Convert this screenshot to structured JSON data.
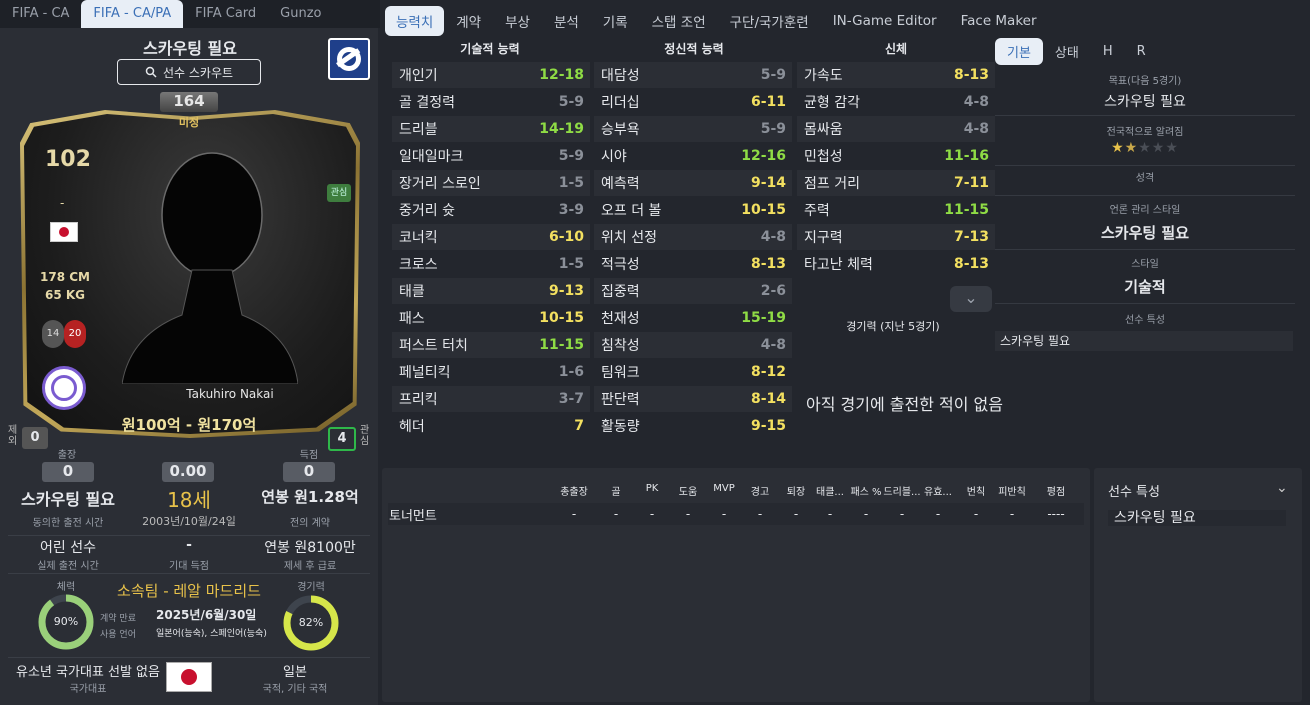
{
  "left_tabs": [
    "FIFA - CA",
    "FIFA - CA/PA",
    "FIFA Card",
    "Gunzo"
  ],
  "player": {
    "title": "스카우팅 필요",
    "scout_button": "선수 스카우트",
    "ca": "164",
    "ca_label": "미정",
    "rating": "102",
    "position": "-",
    "height": "178 CM",
    "weight": "65 KG",
    "num1": "14",
    "num2": "20",
    "interest_tag": "관심",
    "name": "Takuhiro Nakai",
    "value": "원100억 - 원170억",
    "left_box_label": "제외",
    "left_box_val": "0",
    "right_box_val": "4",
    "right_box_label": "관심"
  },
  "stats": {
    "apps_label": "출장",
    "apps": "0",
    "rating": "0.00",
    "goals_label": "득점",
    "goals": "0",
    "playtime": "스카우팅 필요",
    "playtime_label": "동의한 출전 시간",
    "age": "18세",
    "dob": "2003년/10월/24일",
    "wage": "연봉 원1.28억",
    "wage_label": "전의 계약",
    "real_time": "어린 선수",
    "real_time_label": "실제 출전 시간",
    "exp_goals": "-",
    "exp_goals_label": "기대 득점",
    "wage2": "연봉 원8100만",
    "wage2_label": "제세 후 급료",
    "fitness_label": "체력",
    "fitness": "90%",
    "club": "소속팀 - 레알 마드리드",
    "contract_label": "계약 만료",
    "contract": "2025년/6월/30일",
    "lang_label": "사용 언어",
    "langs": "일본어(능숙), 스페인어(능숙)",
    "match_label": "경기력",
    "match": "82%",
    "youth": "유소년 국가대표 선발 없음",
    "youth_label": "국가대표",
    "nation": "일본",
    "nation_label": "국적, 기타 국적"
  },
  "nav": [
    "능력치",
    "계약",
    "부상",
    "분석",
    "기록",
    "스탭 조언",
    "구단/국가훈련",
    "IN-Game Editor",
    "Face Maker"
  ],
  "attr_heads": [
    "기술적 능력",
    "정신적 능력",
    "신체"
  ],
  "technical": [
    {
      "n": "개인기",
      "v": "12-18",
      "c": "g"
    },
    {
      "n": "골 결정력",
      "v": "5-9",
      "c": "gr"
    },
    {
      "n": "드리블",
      "v": "14-19",
      "c": "g"
    },
    {
      "n": "일대일마크",
      "v": "5-9",
      "c": "gr"
    },
    {
      "n": "장거리 스로인",
      "v": "1-5",
      "c": "gr"
    },
    {
      "n": "중거리 슛",
      "v": "3-9",
      "c": "gr"
    },
    {
      "n": "코너킥",
      "v": "6-10",
      "c": "y"
    },
    {
      "n": "크로스",
      "v": "1-5",
      "c": "gr"
    },
    {
      "n": "태클",
      "v": "9-13",
      "c": "y"
    },
    {
      "n": "패스",
      "v": "10-15",
      "c": "y"
    },
    {
      "n": "퍼스트 터치",
      "v": "11-15",
      "c": "g"
    },
    {
      "n": "페널티킥",
      "v": "1-6",
      "c": "gr"
    },
    {
      "n": "프리킥",
      "v": "3-7",
      "c": "gr"
    },
    {
      "n": "헤더",
      "v": "7",
      "c": "y"
    }
  ],
  "mental": [
    {
      "n": "대담성",
      "v": "5-9",
      "c": "gr"
    },
    {
      "n": "리더십",
      "v": "6-11",
      "c": "y"
    },
    {
      "n": "승부욕",
      "v": "5-9",
      "c": "gr"
    },
    {
      "n": "시야",
      "v": "12-16",
      "c": "g"
    },
    {
      "n": "예측력",
      "v": "9-14",
      "c": "y"
    },
    {
      "n": "오프 더 볼",
      "v": "10-15",
      "c": "y"
    },
    {
      "n": "위치 선정",
      "v": "4-8",
      "c": "gr"
    },
    {
      "n": "적극성",
      "v": "8-13",
      "c": "y"
    },
    {
      "n": "집중력",
      "v": "2-6",
      "c": "gr"
    },
    {
      "n": "천재성",
      "v": "15-19",
      "c": "g"
    },
    {
      "n": "침착성",
      "v": "4-8",
      "c": "gr"
    },
    {
      "n": "팀워크",
      "v": "8-12",
      "c": "y"
    },
    {
      "n": "판단력",
      "v": "8-14",
      "c": "y"
    },
    {
      "n": "활동량",
      "v": "9-15",
      "c": "y"
    }
  ],
  "physical": [
    {
      "n": "가속도",
      "v": "8-13",
      "c": "y"
    },
    {
      "n": "균형 감각",
      "v": "4-8",
      "c": "gr"
    },
    {
      "n": "몸싸움",
      "v": "4-8",
      "c": "gr"
    },
    {
      "n": "민첩성",
      "v": "11-16",
      "c": "g"
    },
    {
      "n": "점프 거리",
      "v": "7-11",
      "c": "y"
    },
    {
      "n": "주력",
      "v": "11-15",
      "c": "g"
    },
    {
      "n": "지구력",
      "v": "7-13",
      "c": "y"
    },
    {
      "n": "타고난 체력",
      "v": "8-13",
      "c": "y"
    }
  ],
  "form_label": "경기력 (지난 5경기)",
  "no_games": "아직 경기에 출전한 적이 없음",
  "right_tabs": [
    "기본",
    "상태",
    "H",
    "R"
  ],
  "info": {
    "goal_label": "목표(다음 5경기)",
    "goal": "스카우팅 필요",
    "fame_label": "전국적으로 알려짐",
    "fame_stars": 1.5,
    "personality_label": "성격",
    "media_label": "언론 관리 스타일",
    "media": "스카우팅 필요",
    "style_label": "스타일",
    "style": "기술적",
    "traits_label": "선수 특성",
    "traits": "스카우팅 필요"
  },
  "table": {
    "headers": [
      "총출장",
      "골",
      "PK",
      "도움",
      "MVP",
      "경고",
      "퇴장",
      "태클...",
      "패스 %",
      "드리블...",
      "유효...",
      "번칙",
      "피반칙",
      "평점"
    ],
    "row_label": "토너먼트",
    "row": [
      "-",
      "-",
      "-",
      "-",
      "-",
      "-",
      "-",
      "-",
      "-",
      "-",
      "-",
      "-",
      "-",
      "----"
    ]
  },
  "traits_panel": {
    "title": "선수 특성",
    "value": "스카우팅 필요"
  }
}
